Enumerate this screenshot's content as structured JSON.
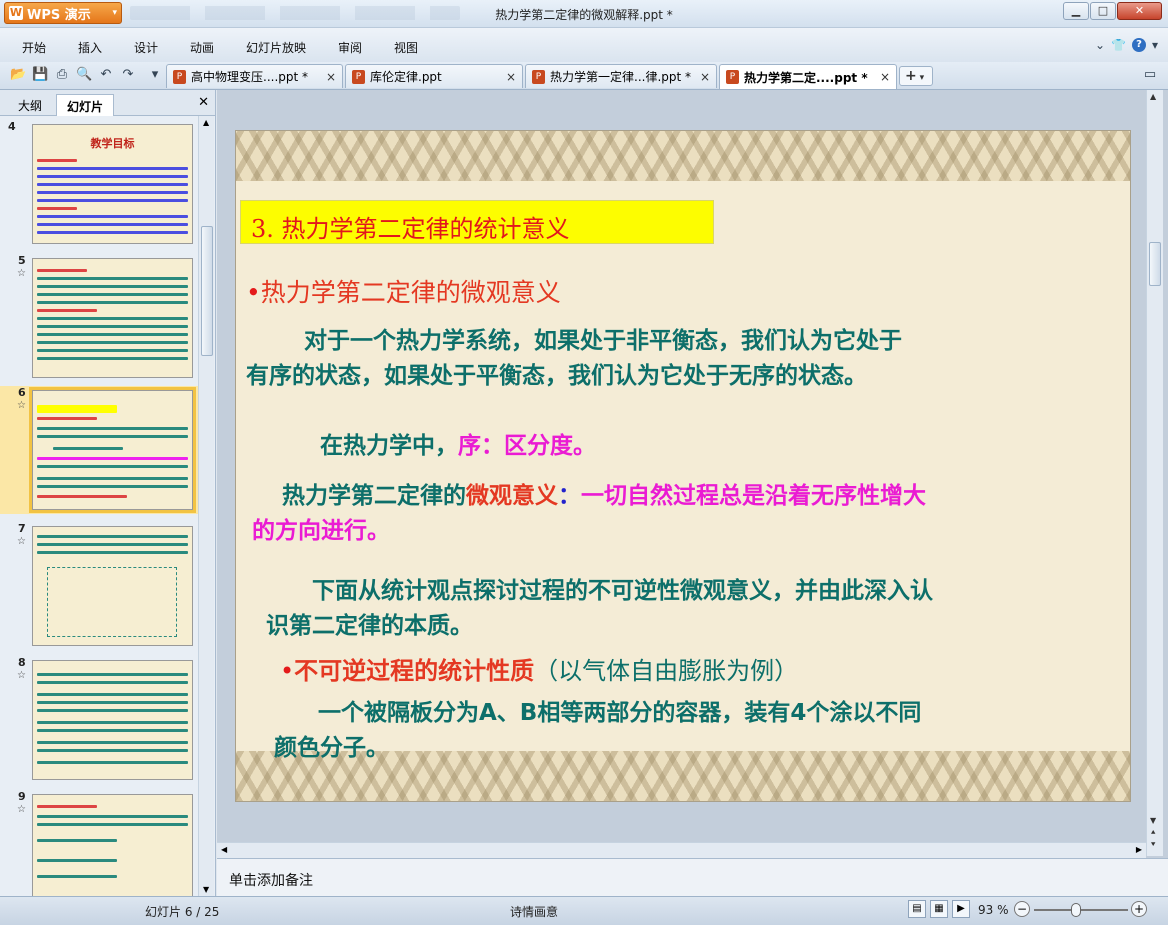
{
  "window": {
    "app_name": "WPS 演示",
    "doc_title": "热力学第二定律的微观解释.ppt *"
  },
  "menu": [
    "开始",
    "插入",
    "设计",
    "动画",
    "幻灯片放映",
    "审阅",
    "视图"
  ],
  "tabs": [
    {
      "label": "高中物理变压....ppt *",
      "active": false
    },
    {
      "label": "库伦定律.ppt",
      "active": false
    },
    {
      "label": "热力学第一定律...律.ppt *",
      "active": false
    },
    {
      "label": "热力学第二定....ppt *",
      "active": true
    }
  ],
  "panel": {
    "tab_outline": "大纲",
    "tab_slides": "幻灯片",
    "slides": [
      {
        "num": "4",
        "star": false,
        "selected": false
      },
      {
        "num": "5",
        "star": true,
        "selected": false
      },
      {
        "num": "6",
        "star": true,
        "selected": true
      },
      {
        "num": "7",
        "star": true,
        "selected": false
      },
      {
        "num": "8",
        "star": true,
        "selected": false
      },
      {
        "num": "9",
        "star": true,
        "selected": false
      }
    ],
    "thumb4_title": "教学目标"
  },
  "slide": {
    "heading": "3. 热力学第二定律的统计意义",
    "sub1": "热力学第二定律的微观意义",
    "p1_line1": "对于一个热力学系统，如果处于非平衡态，我们认为它处于",
    "p1_line2": "有序的状态，如果处于平衡态，我们认为它处于无序的状态。",
    "p2_a": "在热力学中，",
    "p2_b": "序：区分度。",
    "p3_a": "热力学第二定律的",
    "p3_b": "微观意义",
    "p3_c": "：",
    "p3_d": "一切自然过程总是沿着无序性增大",
    "p3_e": "的方向进行。",
    "p4_line1": "下面从统计观点探讨过程的不可逆性微观意义，并由此深入认",
    "p4_line2": "识第二定律的本质。",
    "sub2_a": "不可逆过程的统计性质",
    "sub2_b": "（以气体自由膨胀为例）",
    "p5_line1": "一个被隔板分为A、B相等两部分的容器，装有4个涂以不同",
    "p5_line2": "颜色分子。"
  },
  "notes_placeholder": "单击添加备注",
  "status": {
    "slide_counter": "幻灯片 6 / 25",
    "theme": "诗情画意",
    "zoom": "93 %"
  }
}
